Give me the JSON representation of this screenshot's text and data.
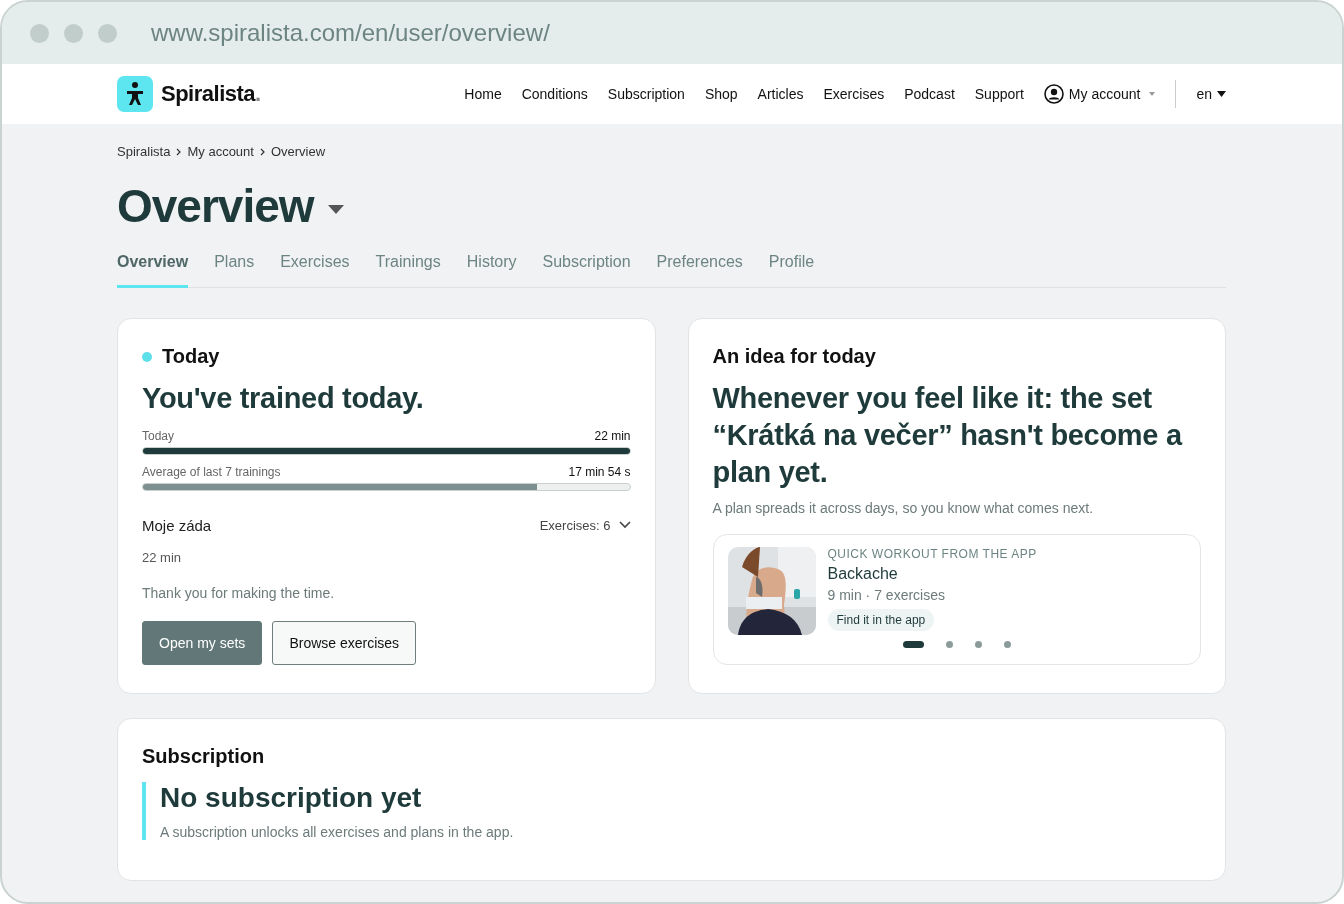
{
  "browser": {
    "url": "www.spiralista.com/en/user/overview/"
  },
  "header": {
    "logo": "Spiralista",
    "logo_dot": ".",
    "nav": [
      "Home",
      "Conditions",
      "Subscription",
      "Shop",
      "Articles",
      "Exercises",
      "Podcast",
      "Support"
    ],
    "account": "My account",
    "language": "en"
  },
  "breadcrumb": [
    "Spiralista",
    "My account",
    "Overview"
  ],
  "page_title": "Overview",
  "tabs": [
    {
      "label": "Overview",
      "selected": true
    },
    {
      "label": "Plans",
      "selected": false
    },
    {
      "label": "Exercises",
      "selected": false
    },
    {
      "label": "Trainings",
      "selected": false
    },
    {
      "label": "History",
      "selected": false
    },
    {
      "label": "Subscription",
      "selected": false
    },
    {
      "label": "Preferences",
      "selected": false
    },
    {
      "label": "Profile",
      "selected": false
    }
  ],
  "today": {
    "title": "Today",
    "headline": "You've trained today.",
    "bars": [
      {
        "label": "Today",
        "reading": "22 min",
        "level": 1.0,
        "kind": "dark"
      },
      {
        "label": "Average of last 7 trainings",
        "reading": "17 min 54 s",
        "level": 0.81,
        "kind": "muted"
      }
    ],
    "set_name": "Moje záda",
    "exercises": "Exercises: 6",
    "duration": "22 min",
    "message": "Thank you for making the time.",
    "buttons": [
      {
        "label": "Open my sets",
        "kind": "primary"
      },
      {
        "label": "Browse exercises",
        "kind": "secondary"
      }
    ]
  },
  "idea": {
    "title": "An idea for today",
    "headline": "Whenever you feel like it: the set “Krátká na večer” hasn't become a plan yet.",
    "text": "A plan spreads it across days, so you know what comes next.",
    "workout": {
      "kind": "picture",
      "eyebrow": "QUICK WORKOUT FROM THE APP",
      "name": "Backache",
      "meta": "9 min · 7 exercises",
      "action": "Find it in the app"
    },
    "dots": [
      {
        "selected": true
      },
      {
        "selected": false
      },
      {
        "selected": false
      },
      {
        "selected": false
      }
    ]
  },
  "subscription": {
    "title": "Subscription",
    "headline": "No subscription yet",
    "text": "A subscription unlocks all exercises and plans in the app."
  }
}
